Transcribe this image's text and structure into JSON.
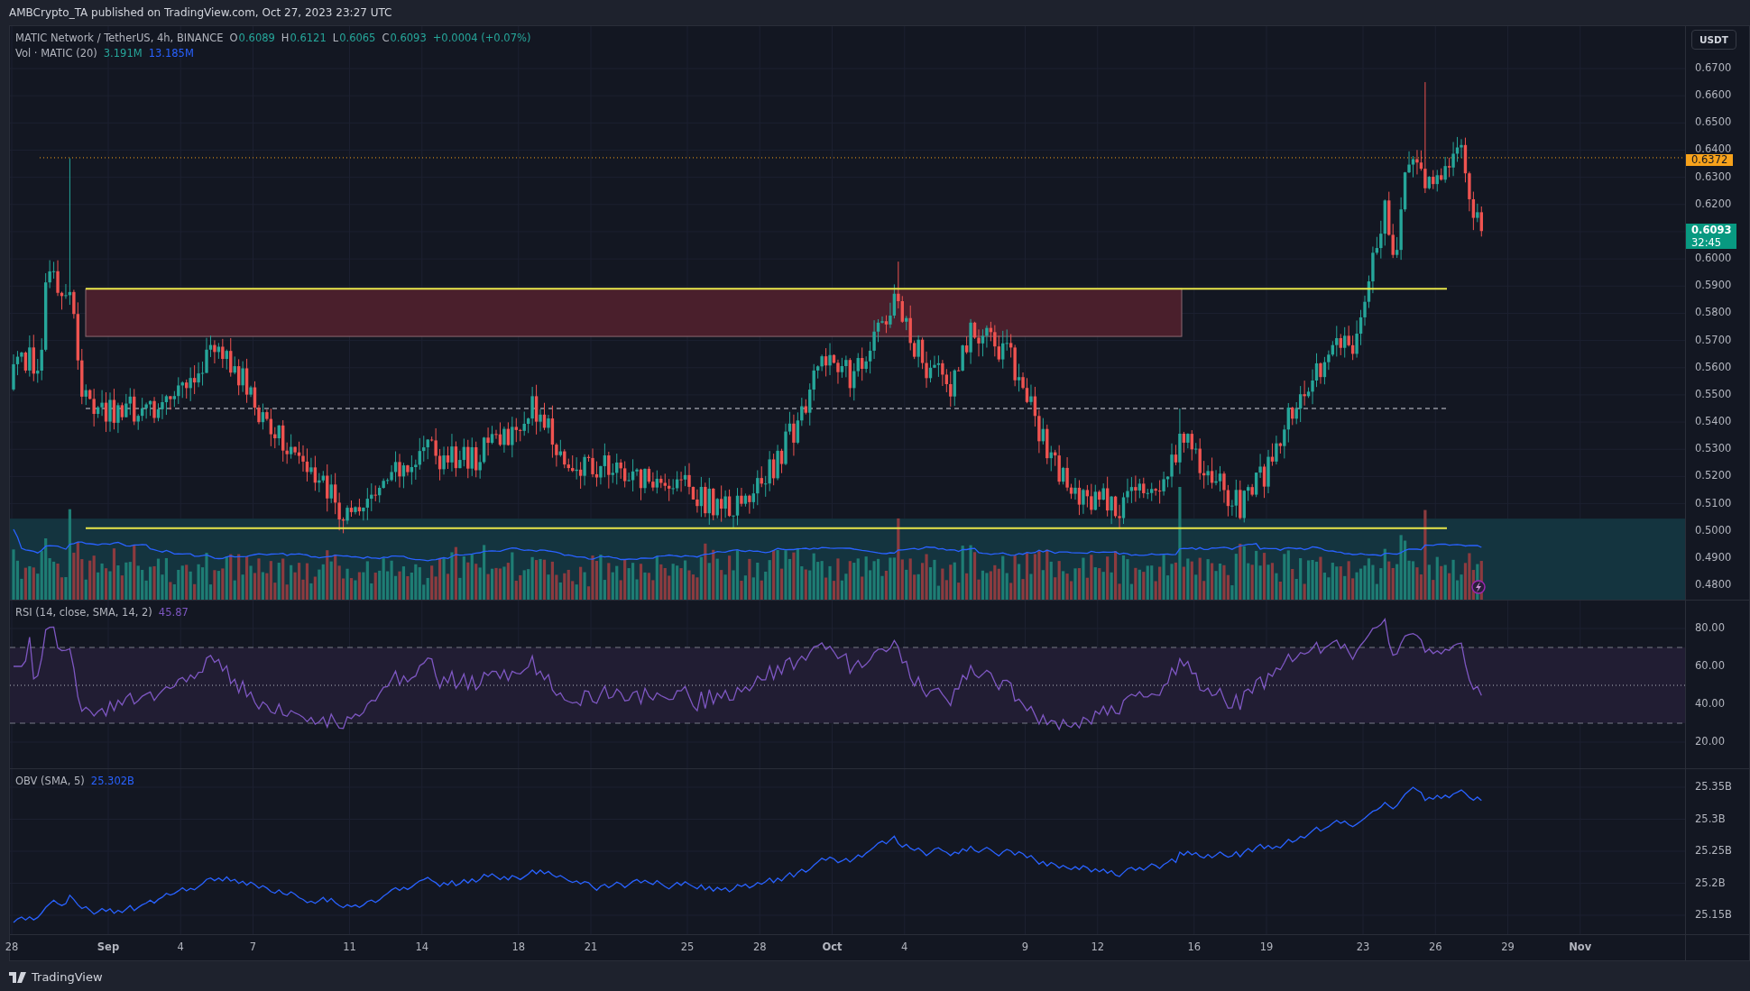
{
  "header": {
    "publisher_line": "AMBCrypto_TA published on TradingView.com, Oct 27, 2023 23:27 UTC"
  },
  "legend": {
    "symbol": "MATIC Network / TetherUS, 4h, BINANCE",
    "ohlc": [
      {
        "label": "O",
        "value": "0.6089"
      },
      {
        "label": "H",
        "value": "0.6121"
      },
      {
        "label": "L",
        "value": "0.6065"
      },
      {
        "label": "C",
        "value": "0.6093"
      }
    ],
    "change": "+0.0004 (+0.07%)"
  },
  "volume_legend": {
    "label": "Vol · MATIC (20)",
    "values": [
      {
        "value": "3.191M",
        "color": "#26a69a"
      },
      {
        "value": "13.185M",
        "color": "#2962ff"
      }
    ]
  },
  "price_axis": {
    "unit": "USDT",
    "ticks": [
      "0.6700",
      "0.6600",
      "0.6500",
      "0.6400",
      "0.6300",
      "0.6200",
      "0.6000",
      "0.5900",
      "0.5800",
      "0.5700",
      "0.5600",
      "0.5500",
      "0.5400",
      "0.5300",
      "0.5200",
      "0.5100",
      "0.5000",
      "0.4900",
      "0.4800"
    ],
    "markers": [
      {
        "kind": "level",
        "value": "0.6372"
      },
      {
        "kind": "last",
        "value": "0.6093",
        "countdown": "32:45"
      }
    ]
  },
  "rsi": {
    "label": "RSI (14, close, SMA, 14, 2)",
    "value": "45.87",
    "ticks": [
      "80.00",
      "60.00",
      "40.00",
      "20.00"
    ]
  },
  "obv": {
    "label": "OBV (SMA, 5)",
    "value": "25.302B",
    "ticks": [
      "25.35B",
      "25.3B",
      "25.25B",
      "25.2B",
      "25.15B"
    ]
  },
  "time_axis": [
    {
      "label": "28",
      "kind": "day"
    },
    {
      "label": "Sep",
      "kind": "month"
    },
    {
      "label": "4",
      "kind": "day"
    },
    {
      "label": "7",
      "kind": "day"
    },
    {
      "label": "11",
      "kind": "day"
    },
    {
      "label": "14",
      "kind": "day"
    },
    {
      "label": "18",
      "kind": "day"
    },
    {
      "label": "21",
      "kind": "day"
    },
    {
      "label": "25",
      "kind": "day"
    },
    {
      "label": "28",
      "kind": "day"
    },
    {
      "label": "Oct",
      "kind": "month"
    },
    {
      "label": "4",
      "kind": "day"
    },
    {
      "label": "9",
      "kind": "day"
    },
    {
      "label": "12",
      "kind": "day"
    },
    {
      "label": "16",
      "kind": "day"
    },
    {
      "label": "19",
      "kind": "day"
    },
    {
      "label": "23",
      "kind": "day"
    },
    {
      "label": "26",
      "kind": "day"
    },
    {
      "label": "29",
      "kind": "day"
    },
    {
      "label": "Nov",
      "kind": "month"
    }
  ],
  "footer": {
    "brand": "TradingView"
  }
}
